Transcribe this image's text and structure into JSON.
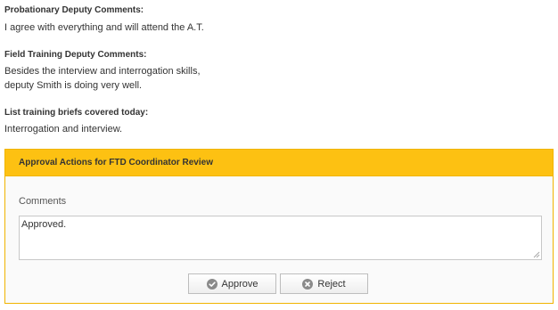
{
  "probationary": {
    "label": "Probationary Deputy Comments:",
    "text": "I agree with everything and will attend the A.T."
  },
  "field_training": {
    "label": "Field Training Deputy Comments:",
    "line1": "Besides the interview and interrogation skills,",
    "line2": "deputy Smith is doing very well."
  },
  "training_briefs": {
    "label": "List training briefs covered today:",
    "text": "Interrogation and interview."
  },
  "approval_panel": {
    "title": "Approval Actions for FTD Coordinator Review",
    "comments_label": "Comments",
    "comments_value": "Approved.",
    "approve_label": "Approve",
    "reject_label": "Reject",
    "approve_icon": "check-circle-icon",
    "reject_icon": "x-circle-icon"
  },
  "colors": {
    "panel_header": "#fdc112",
    "panel_border": "#f0b400",
    "icon_gray": "#8a8a8a"
  }
}
